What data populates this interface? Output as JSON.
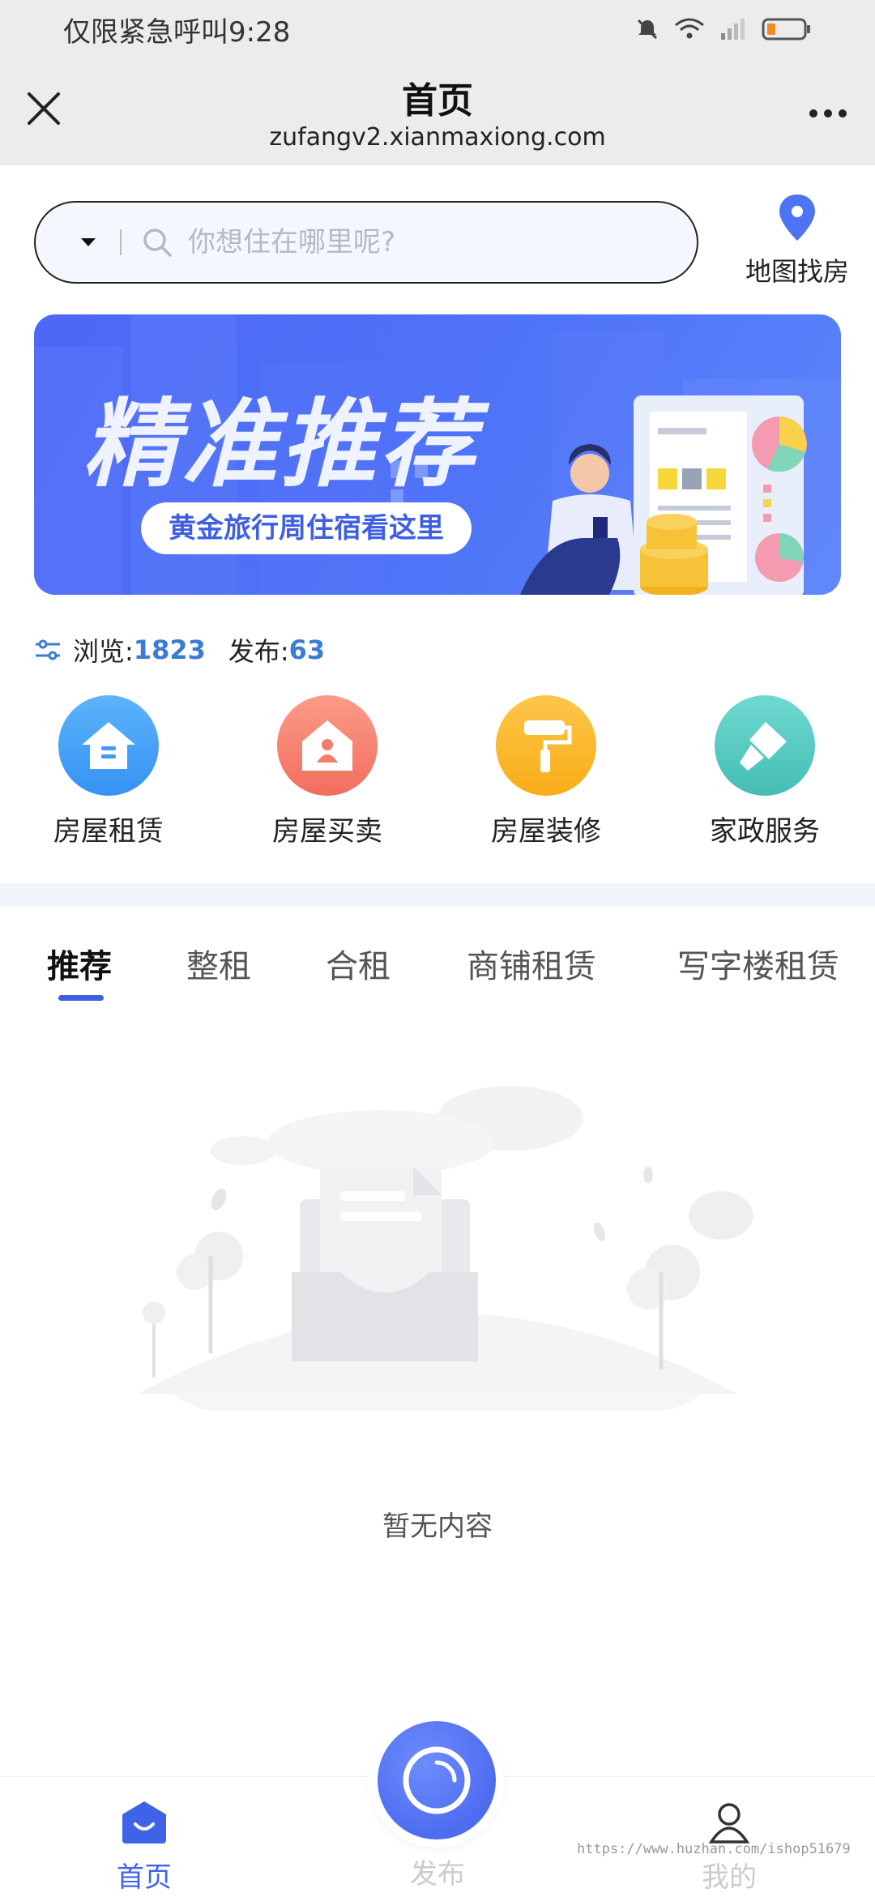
{
  "status_bar": {
    "carrier": "仅限紧急呼叫",
    "time": "9:28"
  },
  "title_bar": {
    "title": "首页",
    "url": "zufangv2.xianmaxiong.com"
  },
  "search": {
    "placeholder": "你想住在哪里呢?"
  },
  "map_find": {
    "label": "地图找房",
    "icon": "map-pin-icon"
  },
  "banner": {
    "title": "精准推荐",
    "subtitle": "黄金旅行周住宿看这里"
  },
  "stats": {
    "views_label": "浏览:",
    "views": "1823",
    "posts_label": "发布:",
    "posts": "63"
  },
  "categories": [
    {
      "label": "房屋租赁",
      "icon": "house-icon",
      "color": "#3c9cf6"
    },
    {
      "label": "房屋买卖",
      "icon": "house-person-icon",
      "color": "#f57c6b"
    },
    {
      "label": "房屋装修",
      "icon": "paint-roller-icon",
      "color": "#fbb726"
    },
    {
      "label": "家政服务",
      "icon": "cleaning-icon",
      "color": "#56cbc3"
    }
  ],
  "tabs": [
    {
      "label": "推荐",
      "active": true
    },
    {
      "label": "整租"
    },
    {
      "label": "合租"
    },
    {
      "label": "商铺租赁"
    },
    {
      "label": "写字楼租赁"
    }
  ],
  "empty_state": {
    "text": "暂无内容"
  },
  "bottom_nav": {
    "home": "首页",
    "publish": "发布",
    "me": "我的",
    "accent": "#3f63e6"
  },
  "watermark": "https://www.huzhan.com/ishop51679"
}
